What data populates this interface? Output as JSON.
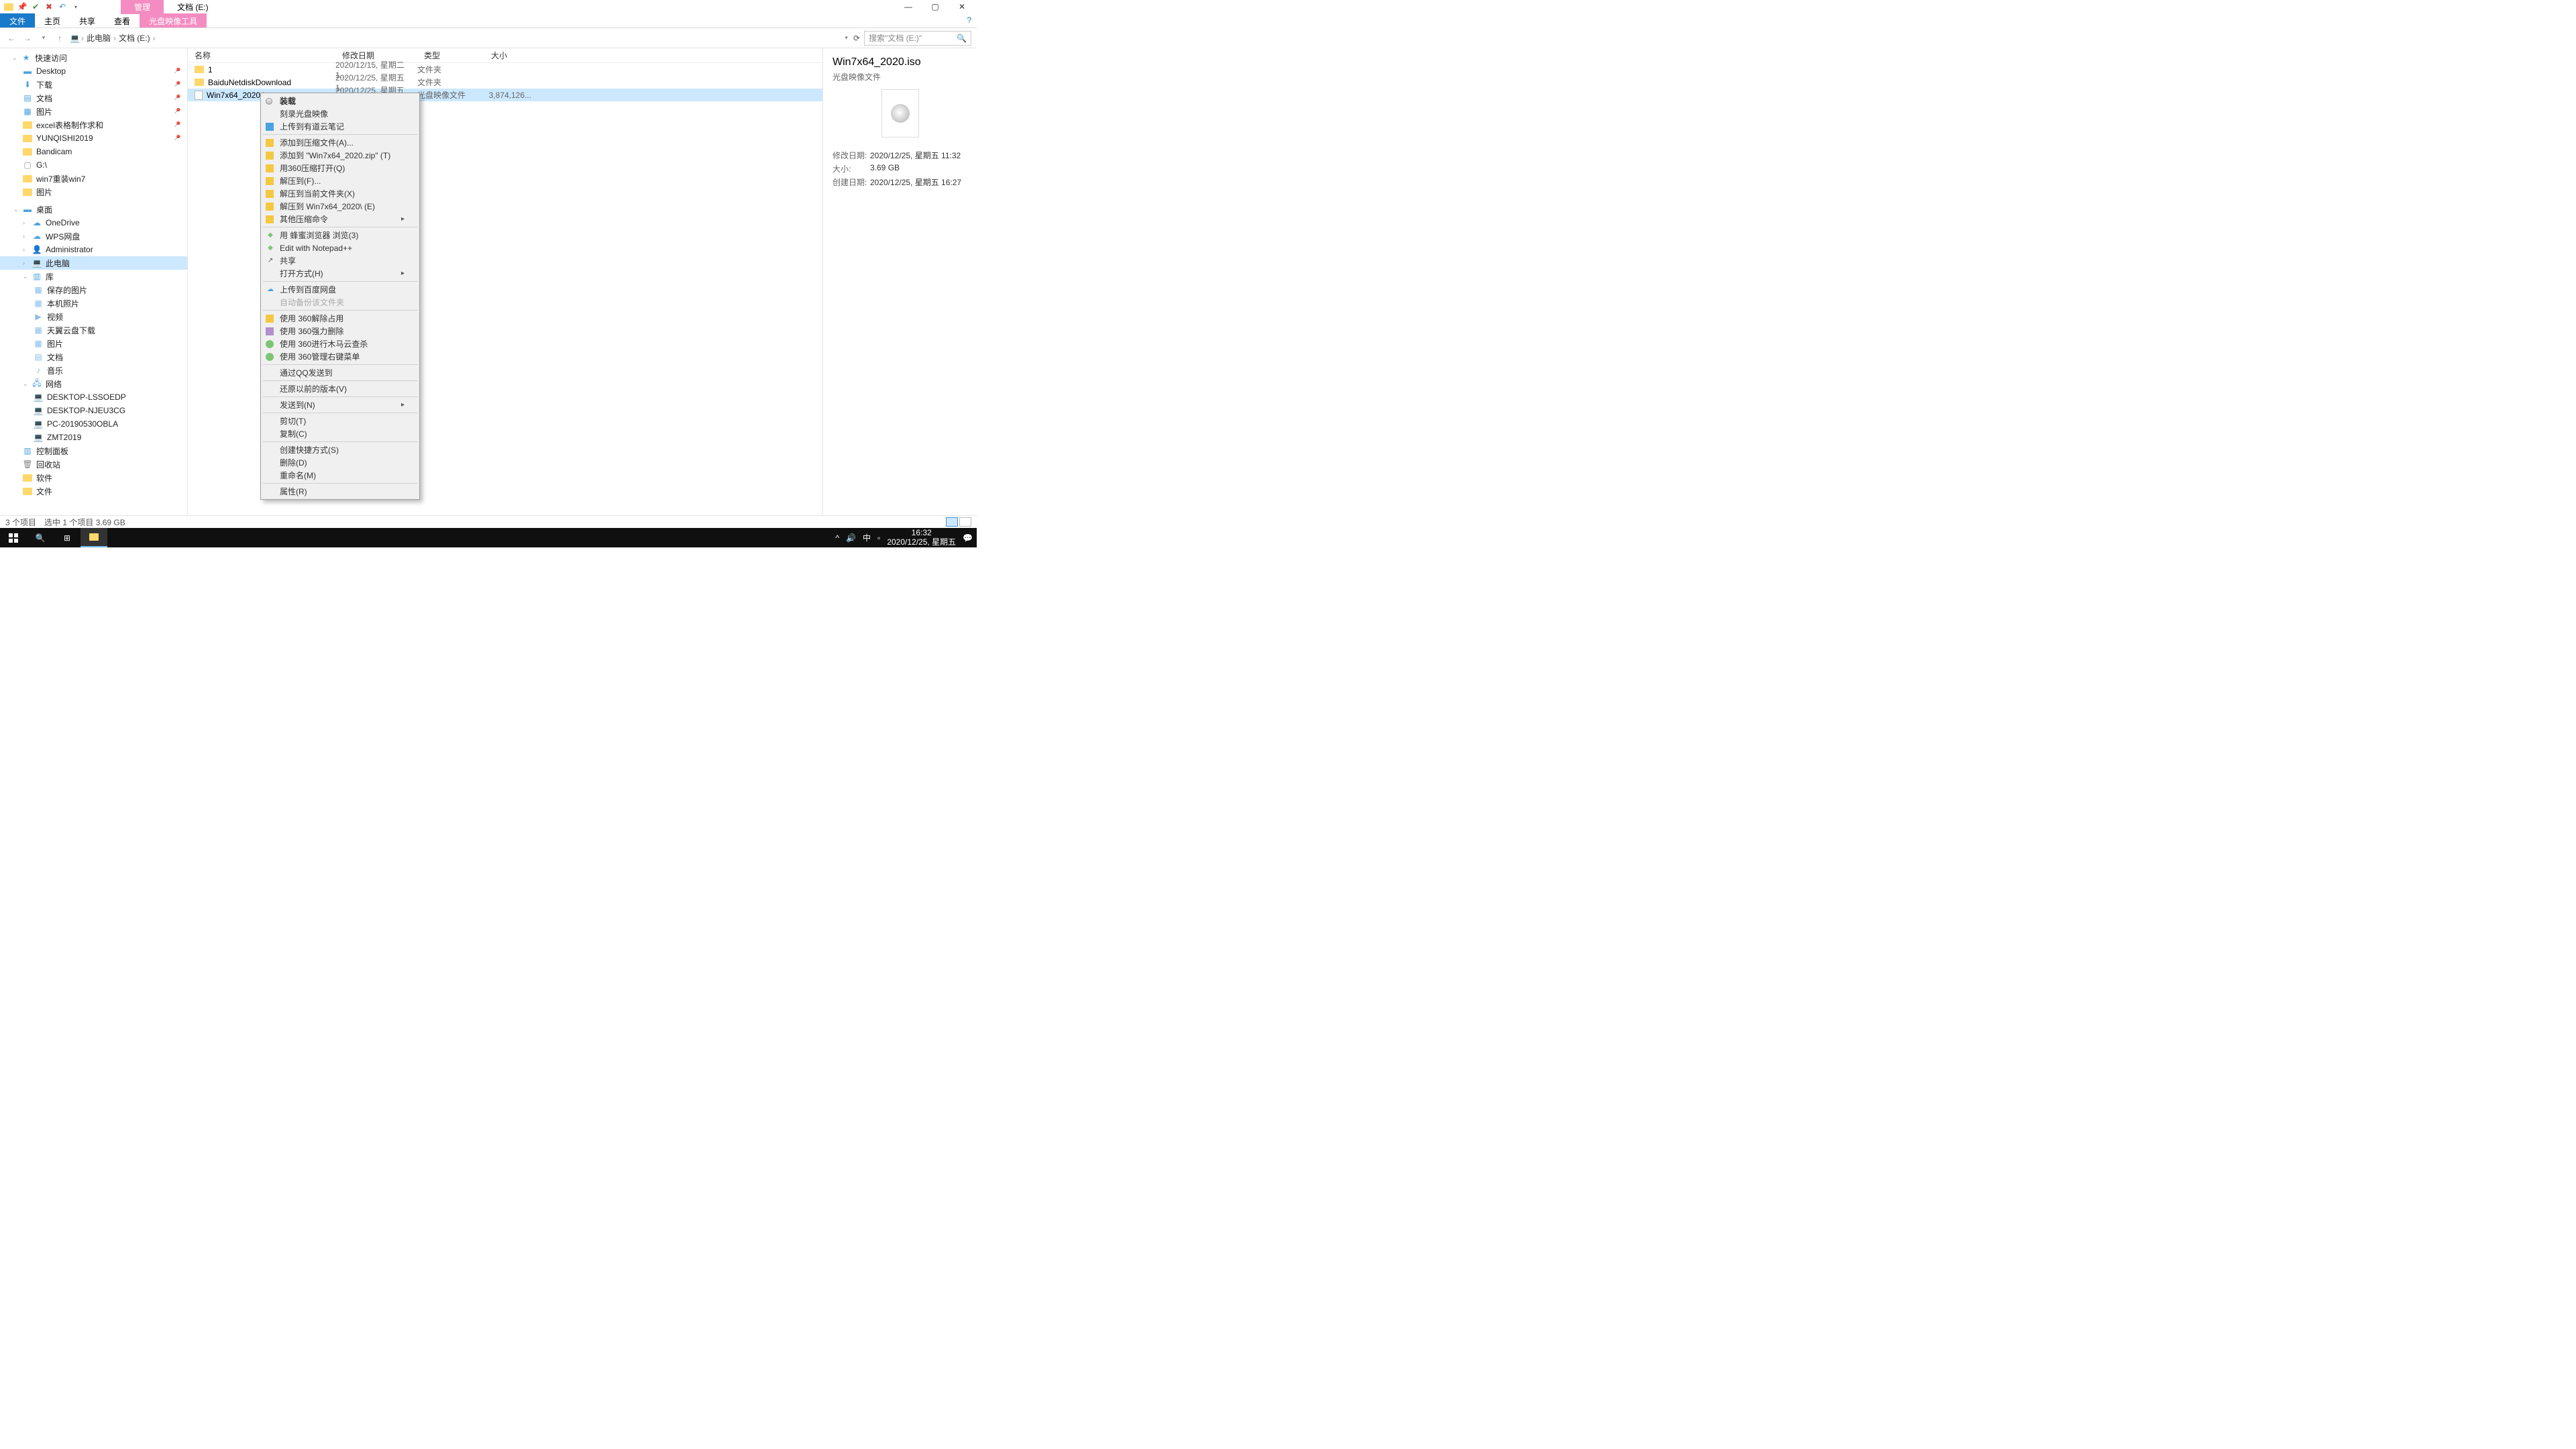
{
  "title_tabs": {
    "manage": "管理",
    "location": "文档 (E:)"
  },
  "ribbon": {
    "file": "文件",
    "home": "主页",
    "share": "共享",
    "view": "查看",
    "disc_tools": "光盘映像工具"
  },
  "addr": {
    "pc": "此电脑",
    "drive": "文档 (E:)"
  },
  "search": {
    "placeholder": "搜索\"文档 (E:)\""
  },
  "sidebar": {
    "quick": "快速访问",
    "items_quick": [
      "Desktop",
      "下载",
      "文档",
      "图片",
      "excel表格制作求和",
      "YUNQISHI2019",
      "Bandicam",
      "G:\\",
      "win7重装win7",
      "图片"
    ],
    "desktop": "桌面",
    "items_desk": [
      "OneDrive",
      "WPS网盘",
      "Administrator",
      "此电脑",
      "库"
    ],
    "lib_items": [
      "保存的图片",
      "本机照片",
      "视频",
      "天翼云盘下载",
      "图片",
      "文档",
      "音乐"
    ],
    "network": "网络",
    "net_items": [
      "DESKTOP-LSSOEDP",
      "DESKTOP-NJEU3CG",
      "PC-20190530OBLA",
      "ZMT2019"
    ],
    "others": [
      "控制面板",
      "回收站",
      "软件",
      "文件"
    ]
  },
  "columns": {
    "name": "名称",
    "date": "修改日期",
    "type": "类型",
    "size": "大小"
  },
  "rows": [
    {
      "name": "1",
      "date": "2020/12/15, 星期二 1...",
      "type": "文件夹",
      "size": ""
    },
    {
      "name": "BaiduNetdiskDownload",
      "date": "2020/12/25, 星期五 1...",
      "type": "文件夹",
      "size": ""
    },
    {
      "name": "Win7x64_2020.iso",
      "date": "2020/12/25, 星期五 1...",
      "type": "光盘映像文件",
      "size": "3,874,126..."
    }
  ],
  "details": {
    "title": "Win7x64_2020.iso",
    "subtitle": "光盘映像文件",
    "mod_label": "修改日期:",
    "mod_val": "2020/12/25, 星期五 11:32",
    "size_label": "大小:",
    "size_val": "3.69 GB",
    "create_label": "创建日期:",
    "create_val": "2020/12/25, 星期五 16:27"
  },
  "status": {
    "count": "3 个项目",
    "sel": "选中 1 个项目  3.69 GB"
  },
  "ctx": [
    "装载",
    "刻录光盘映像",
    "上传到有道云笔记",
    "添加到压缩文件(A)...",
    "添加到 \"Win7x64_2020.zip\" (T)",
    "用360压缩打开(Q)",
    "解压到(F)...",
    "解压到当前文件夹(X)",
    "解压到 Win7x64_2020\\ (E)",
    "其他压缩命令",
    "用 蜂蜜浏览器 浏览(3)",
    "Edit with Notepad++",
    "共享",
    "打开方式(H)",
    "上传到百度网盘",
    "自动备份该文件夹",
    "使用 360解除占用",
    "使用 360强力删除",
    "使用 360进行木马云查杀",
    "使用 360管理右键菜单",
    "通过QQ发送到",
    "还原以前的版本(V)",
    "发送到(N)",
    "剪切(T)",
    "复制(C)",
    "创建快捷方式(S)",
    "删除(D)",
    "重命名(M)",
    "属性(R)"
  ],
  "taskbar": {
    "time": "16:32",
    "date": "2020/12/25, 星期五",
    "ime": "中"
  }
}
